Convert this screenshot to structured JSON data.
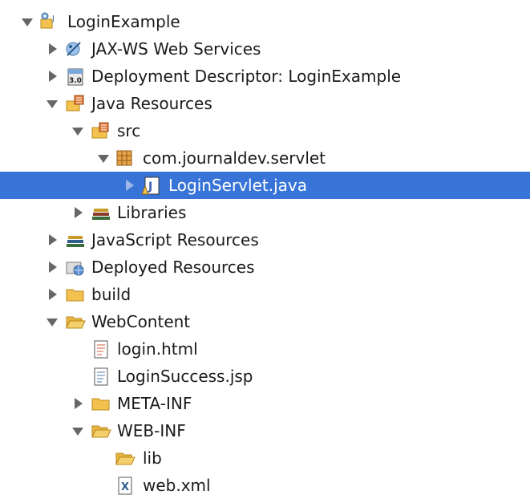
{
  "project_explorer": {
    "root": {
      "label": "LoginExample",
      "icon": "java-web-project-icon",
      "expanded": true
    },
    "jaxws": {
      "label": "JAX-WS Web Services",
      "icon": "web-services-icon",
      "expanded": false
    },
    "deployment_descriptor": {
      "label": "Deployment Descriptor: LoginExample",
      "icon": "deployment-descriptor-icon",
      "expanded": false
    },
    "java_resources": {
      "label": "Java Resources",
      "icon": "java-resources-icon",
      "expanded": true
    },
    "src": {
      "label": "src",
      "icon": "source-folder-icon",
      "expanded": true
    },
    "package": {
      "label": "com.journaldev.servlet",
      "icon": "package-icon",
      "expanded": true
    },
    "servlet_file": {
      "label": "LoginServlet.java",
      "icon": "java-file-icon",
      "expanded": false,
      "selected": true
    },
    "libraries": {
      "label": "Libraries",
      "icon": "libraries-icon",
      "expanded": false
    },
    "js_resources": {
      "label": "JavaScript Resources",
      "icon": "libraries-icon",
      "expanded": false
    },
    "deployed_resources": {
      "label": "Deployed Resources",
      "icon": "deployed-resources-icon",
      "expanded": false
    },
    "build": {
      "label": "build",
      "icon": "folder-icon",
      "expanded": false
    },
    "webcontent": {
      "label": "WebContent",
      "icon": "open-folder-icon",
      "expanded": true
    },
    "login_html": {
      "label": "login.html",
      "icon": "html-file-icon"
    },
    "login_success_jsp": {
      "label": "LoginSuccess.jsp",
      "icon": "jsp-file-icon"
    },
    "meta_inf": {
      "label": "META-INF",
      "icon": "folder-icon",
      "expanded": false
    },
    "web_inf": {
      "label": "WEB-INF",
      "icon": "open-folder-icon",
      "expanded": true
    },
    "lib": {
      "label": "lib",
      "icon": "folder-icon"
    },
    "web_xml": {
      "label": "web.xml",
      "icon": "xml-file-icon"
    }
  },
  "colors": {
    "selection": "#3874d8",
    "selection_text": "#ffffff",
    "text": "#1a1a1a",
    "folder": "#f2c14e",
    "twistie": "#666666"
  }
}
